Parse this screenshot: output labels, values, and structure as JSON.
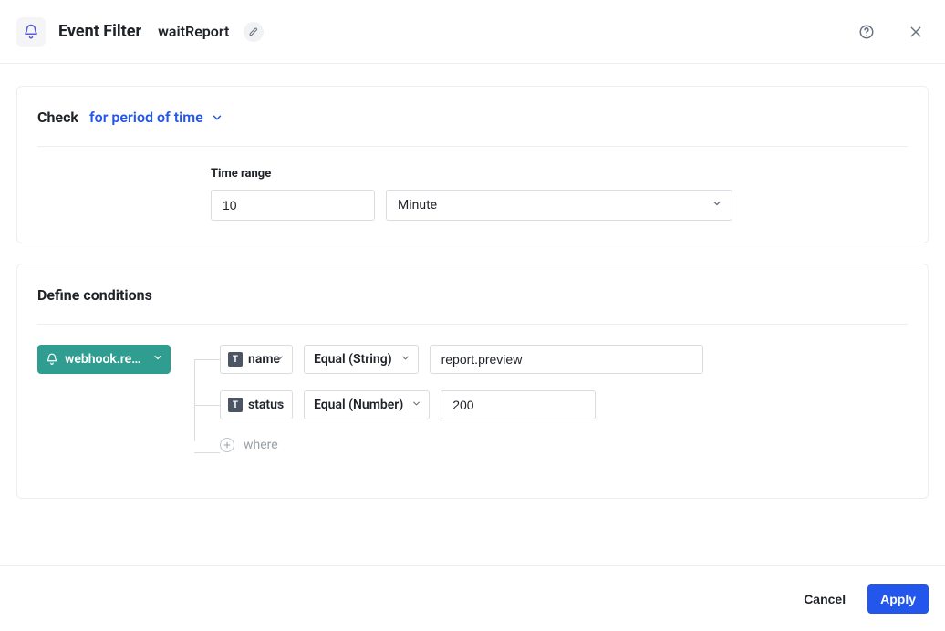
{
  "header": {
    "title": "Event Filter",
    "subtitle": "waitReport"
  },
  "check": {
    "label": "Check",
    "mode": "for period of time",
    "time_range_label": "Time range",
    "time_value": "10",
    "time_unit": "Minute"
  },
  "conditions": {
    "section_title": "Define conditions",
    "source_chip": "webhook.resp...",
    "rows": [
      {
        "field": "name",
        "op": "Equal (String)",
        "value": "report.preview"
      },
      {
        "field": "status",
        "op": "Equal (Number)",
        "value": "200"
      }
    ],
    "add_label": "where"
  },
  "footer": {
    "cancel": "Cancel",
    "apply": "Apply"
  }
}
